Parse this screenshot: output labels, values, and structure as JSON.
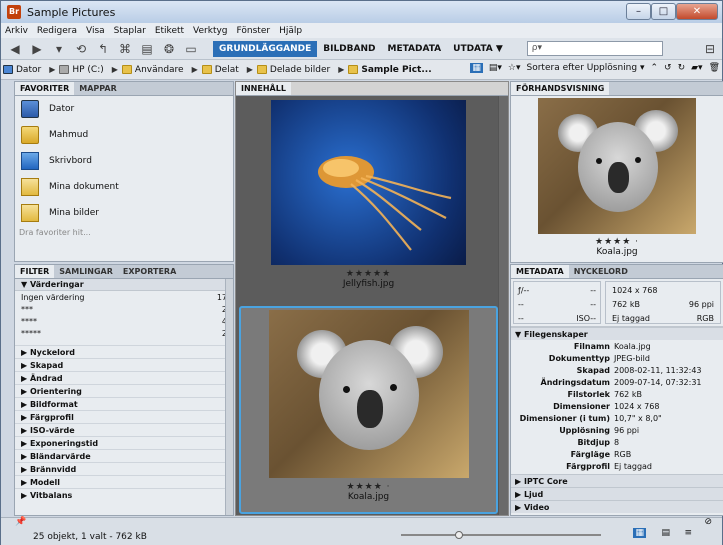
{
  "window": {
    "title": "Sample Pictures",
    "app_icon_text": "Br"
  },
  "menu": [
    "Arkiv",
    "Redigera",
    "Visa",
    "Staplar",
    "Etikett",
    "Verktyg",
    "Fönster",
    "Hjälp"
  ],
  "workspaces": [
    {
      "label": "GRUNDLÄGGANDE",
      "active": true
    },
    {
      "label": "BILDBAND",
      "active": false
    },
    {
      "label": "METADATA",
      "active": false
    },
    {
      "label": "UTDATA ▼",
      "active": false
    }
  ],
  "search": {
    "placeholder": "ρ▾"
  },
  "path": [
    "Dator",
    "HP (C:)",
    "Användare",
    "Delat",
    "Delade bilder",
    "Sample Pict..."
  ],
  "sort_label": "Sortera efter Upplösning ▾",
  "favorites": {
    "tabs": [
      "FAVORITER",
      "MAPPAR"
    ],
    "items": [
      {
        "label": "Dator",
        "icon": "computer-icon"
      },
      {
        "label": "Mahmud",
        "icon": "user-folder-icon"
      },
      {
        "label": "Skrivbord",
        "icon": "desktop-icon"
      },
      {
        "label": "Mina dokument",
        "icon": "documents-icon"
      },
      {
        "label": "Mina bilder",
        "icon": "pictures-icon"
      }
    ],
    "hint": "Dra favoriter hit..."
  },
  "filter": {
    "tabs": [
      "FILTER",
      "SAMLINGAR",
      "EXPORTERA"
    ],
    "ratings_header": "Värderingar",
    "ratings": [
      {
        "label": "Ingen värdering",
        "count": "17"
      },
      {
        "label": "***",
        "count": "2"
      },
      {
        "label": "****",
        "count": "4"
      },
      {
        "label": "*****",
        "count": "2"
      }
    ],
    "categories": [
      "Nyckelord",
      "Skapad",
      "Ändrad",
      "Orientering",
      "Bildformat",
      "Färgprofil",
      "ISO-värde",
      "Exponeringstid",
      "Bländarvärde",
      "Brännvidd",
      "Modell",
      "Vitbalans"
    ]
  },
  "content": {
    "tab": "INNEHÅLL",
    "items": [
      {
        "stars": "★★★★★",
        "name": "Jellyfish.jpg",
        "selected": false
      },
      {
        "stars": "★★★★ ·",
        "name": "Koala.jpg",
        "selected": true
      }
    ]
  },
  "preview": {
    "tab": "FÖRHANDSVISNING",
    "stars": "★★★★ ·",
    "name": "Koala.jpg"
  },
  "metadata": {
    "tabs": [
      "METADATA",
      "NYCKELORD"
    ],
    "camera": {
      "f": "ƒ/--",
      "dash": "--",
      "iso": "ISO--"
    },
    "summary": {
      "dims": "1024 x 768",
      "size": "762 kB",
      "ppi": "96 ppi",
      "tag": "Ej taggad",
      "mode": "RGB"
    },
    "file_section": "Filegenskaper",
    "file_props": [
      {
        "k": "Filnamn",
        "v": "Koala.jpg"
      },
      {
        "k": "Dokumenttyp",
        "v": "JPEG-bild"
      },
      {
        "k": "Skapad",
        "v": "2008-02-11, 11:32:43"
      },
      {
        "k": "Ändringsdatum",
        "v": "2009-07-14, 07:32:31"
      },
      {
        "k": "Filstorlek",
        "v": "762 kB"
      },
      {
        "k": "Dimensioner",
        "v": "1024 x 768"
      },
      {
        "k": "Dimensioner (i tum)",
        "v": "10,7\" x 8,0\""
      },
      {
        "k": "Upplösning",
        "v": "96 ppi"
      },
      {
        "k": "Bitdjup",
        "v": "8"
      },
      {
        "k": "Färgläge",
        "v": "RGB"
      },
      {
        "k": "Färgprofil",
        "v": "Ej taggad"
      }
    ],
    "collapsed_sections": [
      "IPTC Core",
      "Ljud",
      "Video"
    ]
  },
  "status": {
    "text": "25 objekt, 1 valt - 762 kB"
  },
  "colors": {
    "accent": "#2b6fb7",
    "selection": "#4aa3e0"
  }
}
